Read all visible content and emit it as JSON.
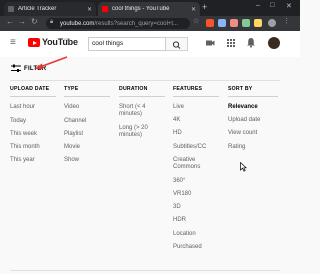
{
  "browser": {
    "tabs": [
      {
        "label": "Article Tracker",
        "favicon_color": "#3c4043"
      },
      {
        "label": "cool things - YouTube",
        "favicon_color": "#ff0000"
      }
    ],
    "address": {
      "host": "youtube.com",
      "rest": "/results?search_query=cool+t..."
    }
  },
  "youtube": {
    "logo_text": "YouTube",
    "logo_region": "GB",
    "search_value": "cool things"
  },
  "filter": {
    "label": "FILTER",
    "columns": [
      {
        "title": "UPLOAD DATE",
        "options": [
          "Last hour",
          "Today",
          "This week",
          "This month",
          "This year"
        ]
      },
      {
        "title": "TYPE",
        "options": [
          "Video",
          "Channel",
          "Playlist",
          "Movie",
          "Show"
        ]
      },
      {
        "title": "DURATION",
        "options": [
          "Short (< 4 minutes)",
          "Long (> 20 minutes)"
        ]
      },
      {
        "title": "FEATURES",
        "options": [
          "Live",
          "4K",
          "HD",
          "Subtitles/CC",
          "Creative Commons",
          "360°",
          "VR180",
          "3D",
          "HDR",
          "Location",
          "Purchased"
        ]
      },
      {
        "title": "SORT BY",
        "options": [
          "Relevance",
          "Upload date",
          "View count",
          "Rating"
        ],
        "selected": "Relevance"
      }
    ]
  },
  "colors": {
    "accent": "#ff0000",
    "annotation": "#e53935"
  }
}
